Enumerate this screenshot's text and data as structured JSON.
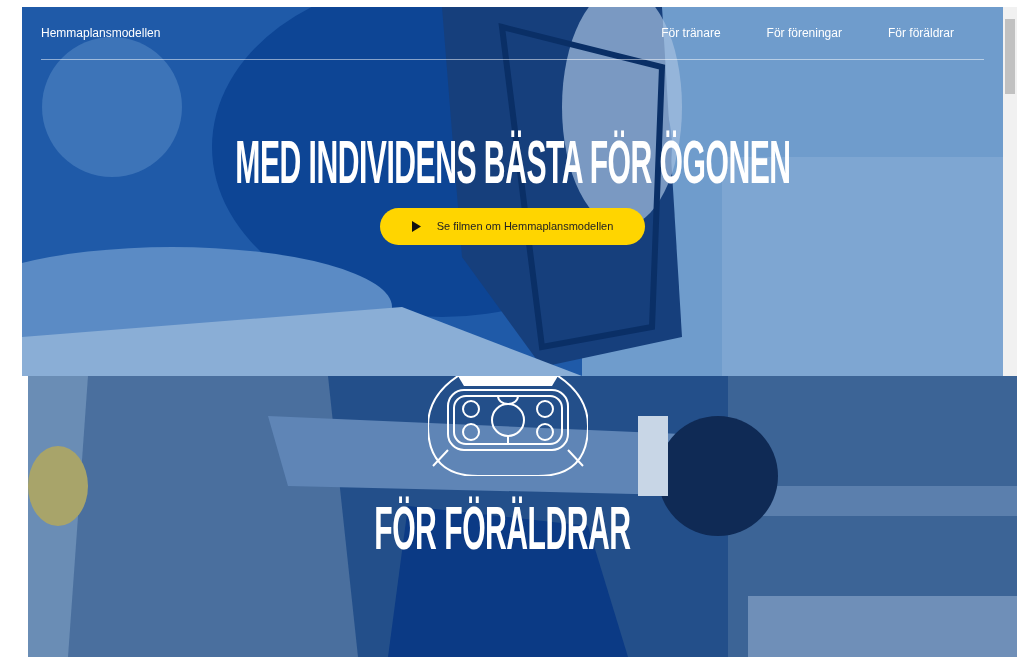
{
  "header": {
    "brand": "Hemmaplansmodellen",
    "nav": [
      {
        "label": "För tränare"
      },
      {
        "label": "För föreningar"
      },
      {
        "label": "För föräldrar"
      }
    ]
  },
  "hero": {
    "headline": "MED INDIVIDENS BÄSTA FÖR ÖGONEN",
    "video_button": {
      "label": "Se filmen om Hemmaplansmodellen"
    }
  },
  "section": {
    "heading": "FÖR FÖRÄLDRAR"
  }
}
